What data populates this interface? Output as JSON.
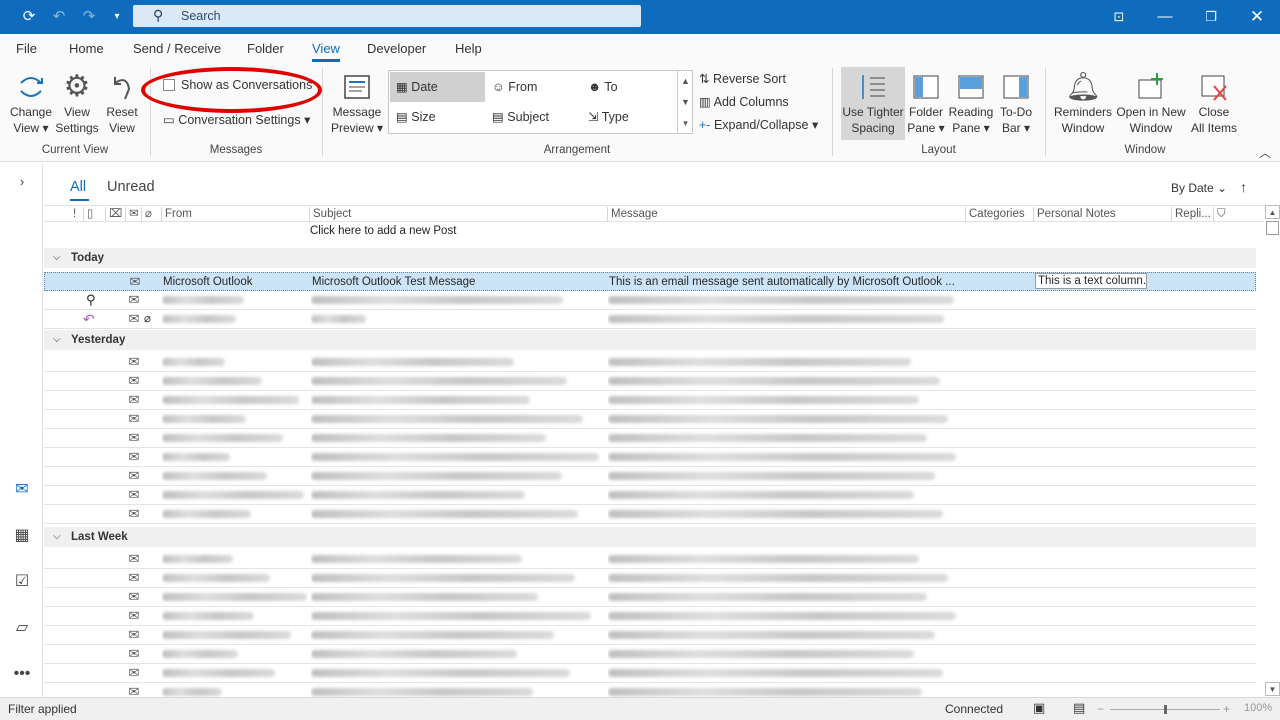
{
  "title_bar": {
    "search_placeholder": "Search"
  },
  "tabs": [
    "File",
    "Home",
    "Send / Receive",
    "Folder",
    "View",
    "Developer",
    "Help"
  ],
  "ribbon": {
    "current_view": {
      "label": "Current View",
      "change_view": [
        "Change",
        "View"
      ],
      "view_settings": [
        "View",
        "Settings"
      ],
      "reset_view": [
        "Reset",
        "View"
      ]
    },
    "messages": {
      "label": "Messages",
      "show_as_conversations": "Show as Conversations",
      "conversation_settings": "Conversation Settings"
    },
    "arrangement": {
      "label": "Arrangement",
      "message_preview": [
        "Message",
        "Preview"
      ],
      "options": {
        "date": "Date",
        "from": "From",
        "to": "To",
        "size": "Size",
        "subject": "Subject",
        "type": "Type"
      },
      "reverse_sort": "Reverse Sort",
      "add_columns": "Add Columns",
      "expand_collapse": "Expand/Collapse"
    },
    "layout": {
      "label": "Layout",
      "use_tighter": [
        "Use Tighter",
        "Spacing"
      ],
      "folder_pane": [
        "Folder",
        "Pane"
      ],
      "reading_pane": [
        "Reading",
        "Pane"
      ],
      "todo_bar": [
        "To-Do",
        "Bar"
      ]
    },
    "window": {
      "label": "Window",
      "reminders": [
        "Reminders",
        "Window"
      ],
      "open_new": [
        "Open in New",
        "Window"
      ],
      "close_all": [
        "Close",
        "All Items"
      ]
    }
  },
  "list": {
    "filter_all": "All",
    "filter_unread": "Unread",
    "sort_by": "By Date",
    "columns": {
      "from": "From",
      "subject": "Subject",
      "message": "Message",
      "categories": "Categories",
      "personal_notes": "Personal Notes",
      "replies": "Repli..."
    },
    "add_post": "Click here to add a new Post",
    "groups": [
      {
        "label": "Today",
        "rows": [
          {
            "from": "Microsoft Outlook",
            "subject": "Microsoft Outlook Test Message",
            "message": "This is an email message sent automatically by Microsoft Outlook ...",
            "notes": "This is a text column."
          }
        ]
      },
      {
        "label": "Yesterday"
      },
      {
        "label": "Last Week"
      }
    ]
  },
  "status": {
    "left": "Filter applied",
    "connected": "Connected",
    "zoom": "100%"
  },
  "colors": {
    "accent": "#0f6cbd",
    "annotation": "#e00000",
    "selected_row": "#cce4f7"
  }
}
